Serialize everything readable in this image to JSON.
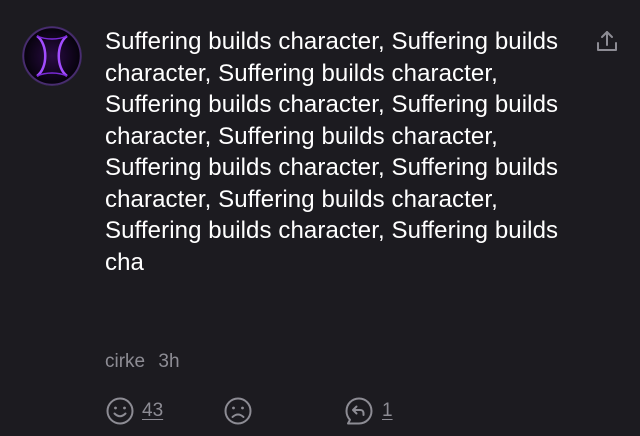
{
  "comment": {
    "text": "Suffering builds character, Suffering builds character, Suffering builds character, Suffering builds character, Suffering builds character, Suffering builds character, Suffering builds character, Suffering builds character, Suffering builds character, Suffering builds character, Suffering builds cha",
    "username": "cirke",
    "time_ago": "3h"
  },
  "actions": {
    "upvote_count": "43",
    "reply_count": "1"
  },
  "icons": {
    "avatar": "purple-hourglass-avatar",
    "share": "share-icon",
    "upvote": "smiley-face-icon",
    "downvote": "sad-face-icon",
    "reply": "reply-arrow-icon"
  },
  "colors": {
    "background": "#1c1b20",
    "text": "#ffffff",
    "muted": "#8d8c94",
    "avatar_accent": "#a24cff"
  }
}
